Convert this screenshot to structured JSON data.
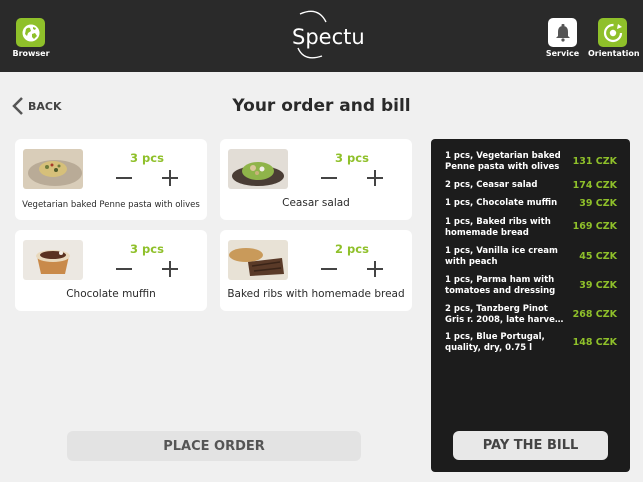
{
  "topbar": {
    "browser_label": "Browser",
    "service_label": "Service",
    "orientation_label": "Orientation",
    "logo_text": "Spectu",
    "accent_color": "#8fc02a"
  },
  "nav": {
    "back_label": "BACK",
    "page_title": "Your order and bill"
  },
  "order_items": [
    {
      "name": "Vegetarian baked Penne pasta with olives",
      "qty": "3 pcs",
      "icon": "pasta-dish-photo"
    },
    {
      "name": "Ceasar salad",
      "qty": "3 pcs",
      "icon": "salad-dish-photo"
    },
    {
      "name": "Chocolate muffin",
      "qty": "3 pcs",
      "icon": "muffin-photo"
    },
    {
      "name": "Baked ribs with homemade bread",
      "qty": "2 pcs",
      "icon": "ribs-dish-photo"
    }
  ],
  "actions": {
    "place_order": "PLACE ORDER",
    "pay_bill": "PAY THE BILL"
  },
  "bill": [
    {
      "item": "1 pcs, Vegetarian baked Penne pasta with olives",
      "price": "131 CZK"
    },
    {
      "item": "2 pcs, Ceasar salad",
      "price": "174 CZK"
    },
    {
      "item": "1 pcs, Chocolate muffin",
      "price": "39 CZK"
    },
    {
      "item": "1 pcs, Baked ribs with homemade bread",
      "price": "169 CZK"
    },
    {
      "item": "1 pcs, Vanilla ice cream with peach",
      "price": "45 CZK"
    },
    {
      "item": "1 pcs, Parma ham with tomatoes and dressing",
      "price": "39 CZK"
    },
    {
      "item": "2 pcs, Tanzberg Pinot Gris r. 2008, late harve…",
      "price": "268 CZK"
    },
    {
      "item": "1 pcs, Blue Portugal, quality, dry, 0.75 l",
      "price": "148 CZK"
    }
  ]
}
